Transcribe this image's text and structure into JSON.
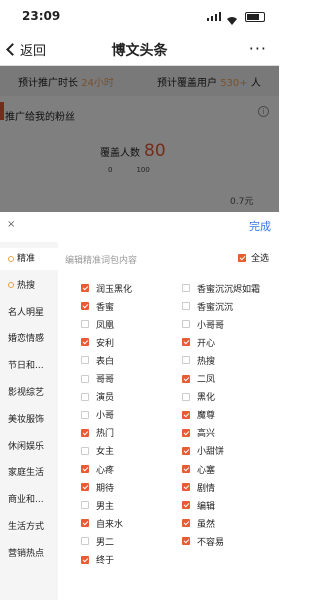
{
  "status": {
    "time": "23:09"
  },
  "nav": {
    "back_label": "返回",
    "title": "博文头条",
    "more": "···"
  },
  "background": {
    "duration_label": "预计推广时长",
    "duration_value": "24小时",
    "reach_label": "预计覆盖用户",
    "reach_value": "530+",
    "reach_unit": "人",
    "section_title": "推广给我的粉丝",
    "cover_label": "覆盖人数",
    "cover_value": "80",
    "axis_left": "0",
    "axis_right": "100",
    "right_note": "0.7元"
  },
  "panel": {
    "close_label": "×",
    "done_label": "完成",
    "hint": "编辑精准词包内容",
    "select_all_label": "全选",
    "select_all_checked": true
  },
  "categories": [
    {
      "label": "精准",
      "selected": true,
      "dot": true
    },
    {
      "label": "热搜",
      "selected": false,
      "dot": true
    },
    {
      "label": "名人明星",
      "selected": false,
      "dot": false
    },
    {
      "label": "婚恋情感",
      "selected": false,
      "dot": false
    },
    {
      "label": "节日和...",
      "selected": false,
      "dot": false
    },
    {
      "label": "影视综艺",
      "selected": false,
      "dot": false
    },
    {
      "label": "美妆服饰",
      "selected": false,
      "dot": false
    },
    {
      "label": "休闲娱乐",
      "selected": false,
      "dot": false
    },
    {
      "label": "家庭生活",
      "selected": false,
      "dot": false
    },
    {
      "label": "商业和...",
      "selected": false,
      "dot": false
    },
    {
      "label": "生活方式",
      "selected": false,
      "dot": false
    },
    {
      "label": "营销热点",
      "selected": false,
      "dot": false
    }
  ],
  "keywords_left": [
    {
      "label": "润玉黑化",
      "checked": true
    },
    {
      "label": "香蜜",
      "checked": true
    },
    {
      "label": "凤凰",
      "checked": false
    },
    {
      "label": "安利",
      "checked": true
    },
    {
      "label": "表白",
      "checked": false
    },
    {
      "label": "哥哥",
      "checked": false
    },
    {
      "label": "演员",
      "checked": false
    },
    {
      "label": "小哥",
      "checked": false
    },
    {
      "label": "热门",
      "checked": true
    },
    {
      "label": "女主",
      "checked": false
    },
    {
      "label": "心疼",
      "checked": true
    },
    {
      "label": "期待",
      "checked": true
    },
    {
      "label": "男主",
      "checked": false
    },
    {
      "label": "自来水",
      "checked": true
    },
    {
      "label": "男二",
      "checked": false
    },
    {
      "label": "终于",
      "checked": true
    }
  ],
  "keywords_right": [
    {
      "label": "香蜜沉沉烬如霜",
      "checked": false
    },
    {
      "label": "香蜜沉沉",
      "checked": false
    },
    {
      "label": "小哥哥",
      "checked": false
    },
    {
      "label": "开心",
      "checked": true
    },
    {
      "label": "热搜",
      "checked": false
    },
    {
      "label": "二凤",
      "checked": true
    },
    {
      "label": "黑化",
      "checked": false
    },
    {
      "label": "魔尊",
      "checked": true
    },
    {
      "label": "高兴",
      "checked": true
    },
    {
      "label": "小甜饼",
      "checked": true
    },
    {
      "label": "心塞",
      "checked": true
    },
    {
      "label": "剧情",
      "checked": true
    },
    {
      "label": "编辑",
      "checked": true
    },
    {
      "label": "虽然",
      "checked": true
    },
    {
      "label": "不容易",
      "checked": true
    }
  ]
}
